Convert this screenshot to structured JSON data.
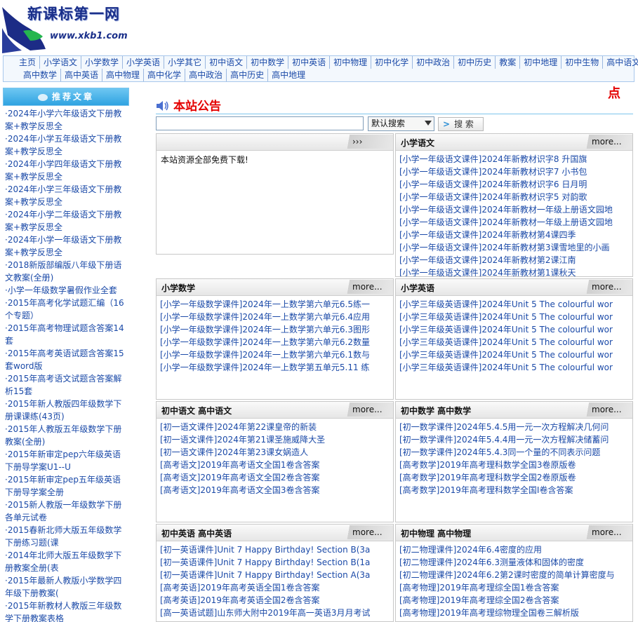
{
  "logo": {
    "title": "新课标第一网",
    "url": "www.xkb1.com"
  },
  "nav": {
    "row1": [
      "主页",
      "小学语文",
      "小学数学",
      "小学英语",
      "小学其它",
      "初中语文",
      "初中数学",
      "初中英语",
      "初中物理",
      "初中化学",
      "初中政治",
      "初中历史",
      "教案",
      "初中地理",
      "初中生物",
      "高中语文"
    ],
    "row2": [
      "高中数学",
      "高中英语",
      "高中物理",
      "高中化学",
      "高中政治",
      "高中历史",
      "高中地理"
    ]
  },
  "sidebar": {
    "title": "推荐文章",
    "items": [
      "·2024年小学六年级语文下册教案+教学反思全",
      "·2024年小学五年级语文下册教案+教学反思全",
      "·2024年小学四年级语文下册教案+教学反思全",
      "·2024年小学三年级语文下册教案+教学反思全",
      "·2024年小学二年级语文下册教案+教学反思全",
      "·2024年小学一年级语文下册教案+教学反思全",
      "·2018新版部编版八年级下册语文教案(全册)",
      "·小学一年级数学暑假作业全套",
      "·2015年高考化学试题汇编（16个专题）",
      "·2015年高考物理试题含答案14套",
      "·2015年高考英语试题含答案15套word版",
      "·2015年高考语文试题含答案解析15套",
      "·2015年新人教版四年级数学下册课课练(43页)",
      "·2015年人教版五年级数学下册教案(全册)",
      "·2015年新审定pep六年级英语下册导学案U1--U",
      "·2015年新审定pep五年级英语下册导学案全册",
      "·2015新人教版一年级数学下册各单元试卷",
      "·2015春新北师大版五年级数学下册练习题(课",
      "·2014年北师大版五年级数学下册教案全册(表",
      "·2015年最新人教版小学数学四年级下册教案(",
      "·2015年新教材人教版三年级数学下册教案表格"
    ]
  },
  "announce": {
    "title": "本站公告",
    "right_char": "点"
  },
  "search": {
    "input_value": "",
    "select_value": "默认搜索",
    "button_label": "搜 索",
    "button_prefix": ">"
  },
  "boxes": {
    "notice": {
      "title": "",
      "more": "›››",
      "text": "本站资源全部免费下载!"
    },
    "xiaoxue_yuwen": {
      "title": "小学语文",
      "more": "more...",
      "items": [
        "[小学一年级语文课件]2024年新教材识字8 升国旗",
        "[小学一年级语文课件]2024年新教材识字7 小书包",
        "[小学一年级语文课件]2024年新教材识字6 日月明",
        "[小学一年级语文课件]2024年新教材识字5 对韵歌",
        "[小学一年级语文课件]2024年新教材一年级上册语文园地",
        "[小学一年级语文课件]2024年新教材一年级上册语文园地",
        "[小学一年级语文课件]2024年新教材第4课四季",
        "[小学一年级语文课件]2024年新教材第3课雪地里的小画",
        "[小学一年级语文课件]2024年新教材第2课江南",
        "[小学一年级语文课件]2024年新教材第1课秋天"
      ]
    },
    "xiaoxue_shuxue": {
      "title": "小学数学",
      "more": "more...",
      "items": [
        "[小学一年级数学课件]2024年一上数学第六单元6.5练一",
        "[小学一年级数学课件]2024年一上数学第六单元6.4应用",
        "[小学一年级数学课件]2024年一上数学第六单元6.3图形",
        "[小学一年级数学课件]2024年一上数学第六单元6.2数量",
        "[小学一年级数学课件]2024年一上数学第六单元6.1数与",
        "[小学一年级数学课件]2024年一上数学第五单元5.11 练"
      ]
    },
    "xiaoxue_yingyu": {
      "title": "小学英语",
      "more": "more...",
      "items": [
        "[小学三年级英语课件]2024年Unit 5 The colourful wor",
        "[小学三年级英语课件]2024年Unit 5 The colourful wor",
        "[小学三年级英语课件]2024年Unit 5 The colourful wor",
        "[小学三年级英语课件]2024年Unit 5 The colourful wor",
        "[小学三年级英语课件]2024年Unit 5 The colourful wor",
        "[小学三年级英语课件]2024年Unit 5 The colourful wor"
      ]
    },
    "yuwen": {
      "title": "初中语文   高中语文",
      "more": "more...",
      "items": [
        "[初一语文课件]2024年第22课皇帝的新装",
        "[初一语文课件]2024年第21课圣施威降大圣",
        "[初一语文课件]2024年第23课女娲造人",
        "[高考语文]2019年高考语文全国1卷含答案",
        "[高考语文]2019年高考语文全国2卷含答案",
        "[高考语文]2019年高考语文全国3卷含答案"
      ]
    },
    "shuxue": {
      "title": "初中数学   高中数学",
      "more": "more...",
      "items": [
        "[初一数学课件]2024年5.4.5用一元一次方程解决几何问",
        "[初一数学课件]2024年5.4.4用一元一次方程解决储蓄问",
        "[初一数学课件]2024年5.4.3同一个量的不同表示问题",
        "[高考数学]2019年高考理科数学全国3卷原版卷",
        "[高考数学]2019年高考理科数学全国2卷原版卷",
        "[高考数学]2019年高考理科数学全国I卷含答案"
      ]
    },
    "yingyu": {
      "title": "初中英语   高中英语",
      "more": "more...",
      "items": [
        "[初一英语课件]Unit 7 Happy Birthday! Section B(3a",
        "[初一英语课件]Unit 7 Happy Birthday! Section B(1a",
        "[初一英语课件]Unit 7 Happy Birthday! Section A(3a",
        "[高考英语]2019年高考英语全国1卷含答案",
        "[高考英语]2019年高考英语全国2卷含答案",
        "[高一英语试题]山东师大附中2019年高一英语3月月考试"
      ]
    },
    "wuli": {
      "title": "初中物理   高中物理",
      "more": "more...",
      "items": [
        "[初二物理课件]2024年6.4密度的应用",
        "[初二物理课件]2024年6.3测量液体和固体的密度",
        "[初二物理课件]2024年6.2第2课时密度的简单计算密度与",
        "[高考物理]2019年高考理综全国1卷含答案",
        "[高考物理]2019年高考理综全国2卷含答案",
        "[高考物理]2019年高考理综物理全国卷三解析版"
      ]
    }
  }
}
